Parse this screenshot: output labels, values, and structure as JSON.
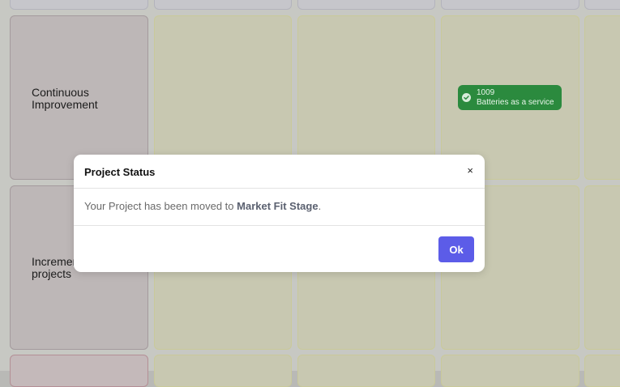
{
  "board": {
    "rows": [
      {
        "label": "Continuous\nImprovement"
      },
      {
        "label": "Incremental\nprojects"
      }
    ],
    "chip": {
      "id": "1009",
      "name": "Batteries as a service",
      "color": "#2b8a3e",
      "icon": "check-circle-icon"
    }
  },
  "modal": {
    "title": "Project Status",
    "close_label": "×",
    "message_prefix": "Your Project has been moved to ",
    "message_stage": "Market Fit Stage",
    "message_suffix": ".",
    "ok_label": "Ok",
    "accent": "#5c5ce8"
  }
}
